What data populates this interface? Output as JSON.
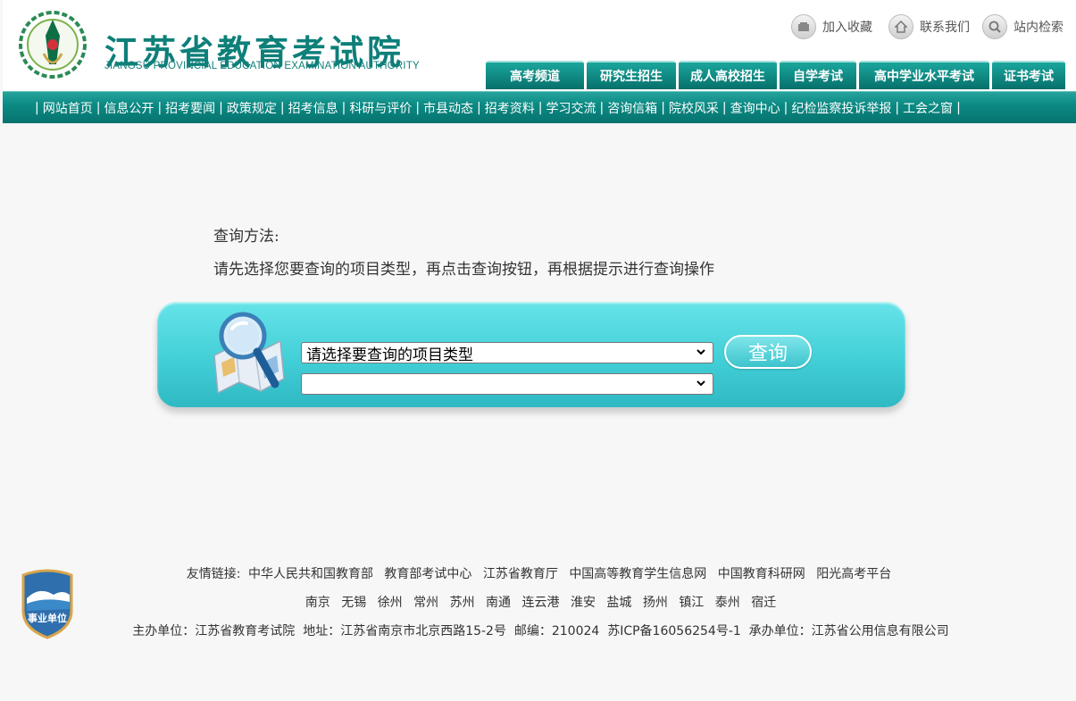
{
  "header": {
    "logo_cn": "江苏省教育考试院",
    "logo_en": "JIANGSU PROVINCIAL EDUCATION EXAMINATION AUTHORITY",
    "quick_links": [
      {
        "label": "加入收藏",
        "icon": "bookmark-icon"
      },
      {
        "label": "联系我们",
        "icon": "home-icon"
      },
      {
        "label": "站内检索",
        "icon": "search-icon"
      }
    ],
    "tabs": [
      "高考频道",
      "研究生招生",
      "成人高校招生",
      "自学考试",
      "高中学业水平考试",
      "证书考试"
    ]
  },
  "nav": {
    "items": [
      "网站首页",
      "信息公开",
      "招考要闻",
      "政策规定",
      "招考信息",
      "科研与评价",
      "市县动态",
      "招考资料",
      "学习交流",
      "咨询信箱",
      "院校风采",
      "查询中心",
      "纪检监察投诉举报",
      "工会之窗"
    ],
    "separator": "|"
  },
  "main": {
    "method_title": "查询方法:",
    "method_text": "请先选择您要查询的项目类型，再点击查询按钮，再根据提示进行查询操作",
    "select1_value": "请选择要查询的项目类型",
    "select2_value": "",
    "query_button": "查询"
  },
  "footer": {
    "friend_label": "友情链接:",
    "friend_links": [
      "中华人民共和国教育部",
      "教育部考试中心",
      "江苏省教育厅",
      "中国高等教育学生信息网",
      "中国教育科研网",
      "阳光高考平台"
    ],
    "cities": [
      "南京",
      "无锡",
      "徐州",
      "常州",
      "苏州",
      "南通",
      "连云港",
      "淮安",
      "盐城",
      "扬州",
      "镇江",
      "泰州",
      "宿迁"
    ],
    "info": "主办单位：江苏省教育考试院  地址：江苏省南京市北京西路15-2号  邮编：210024  苏ICP备16056254号-1  承办单位：江苏省公用信息有限公司",
    "badge_text": "事业单位"
  },
  "colors": {
    "brand": "#0e7f79",
    "nav_bar": "#0c8a84",
    "query_box": "#43cfd7"
  }
}
